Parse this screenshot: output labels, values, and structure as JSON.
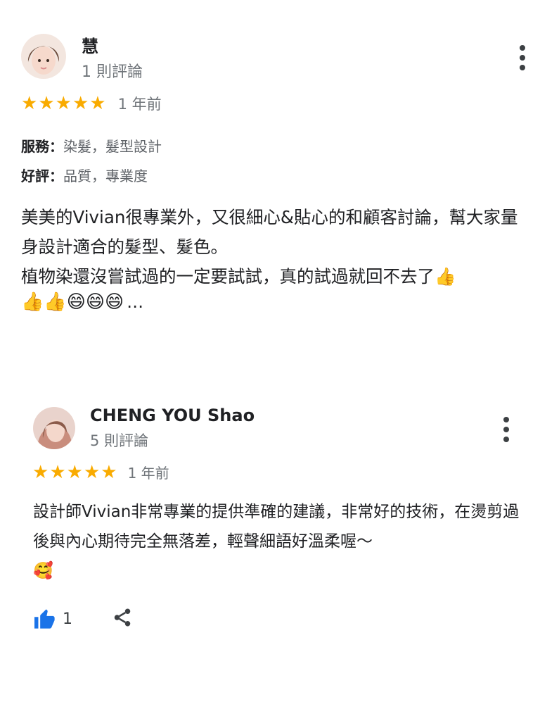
{
  "reviews": [
    {
      "author": "慧",
      "review_count": "1 則評論",
      "stars": 5,
      "time": "1 年前",
      "attributes": [
        {
          "key": "服務：",
          "value": "染髮，髮型設計"
        },
        {
          "key": "好評：",
          "value": "品質，專業度"
        }
      ],
      "text": "美美的Vivian很專業外，又很細心&貼心的和顧客討論，幫大家量身設計適合的髮型、髮色。\n植物染還沒嘗試過的一定要試試，真的試過就回不去了👍",
      "emoji_tail": "👍👍😄😄😄",
      "ellipsis": "…"
    },
    {
      "author": "CHENG YOU Shao",
      "review_count": "5 則評論",
      "stars": 5,
      "time": "1 年前",
      "text": "設計師Vivian非常專業的提供準確的建議，非常好的技術，在燙剪過後與內心期待完全無落差，輕聲細語好溫柔喔～\n🥰",
      "likes": "1"
    }
  ],
  "colors": {
    "star": "#f9ab00",
    "like": "#1a73e8",
    "secondary_text": "#70757a"
  },
  "icons": [
    "more-vert-icon",
    "star-icon",
    "thumb-up-icon",
    "share-icon"
  ]
}
